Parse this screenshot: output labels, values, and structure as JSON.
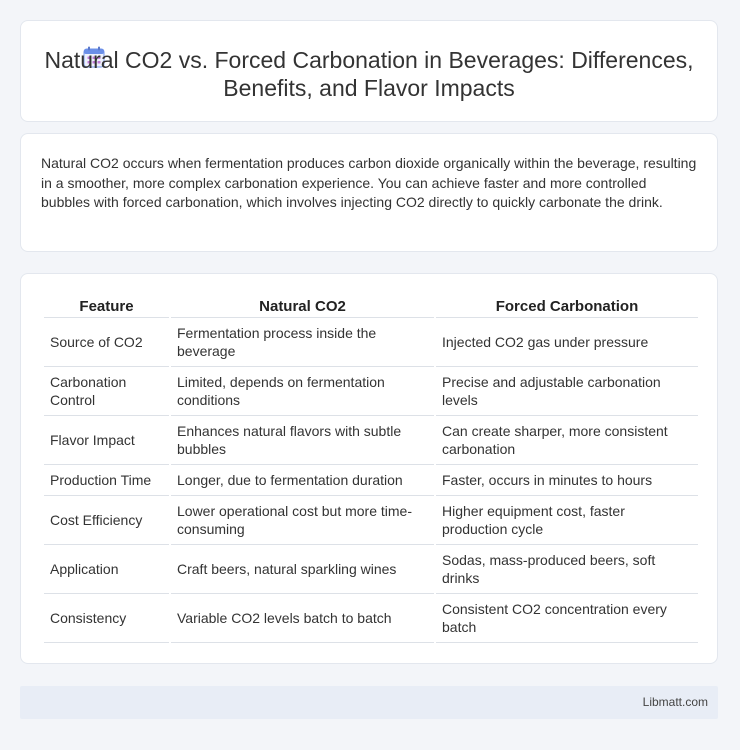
{
  "header": {
    "title": "Natural CO2 vs. Forced Carbonation in Beverages: Differences, Benefits, and Flavor Impacts",
    "icon": "calendar-icon"
  },
  "intro": {
    "text": "Natural CO2 occurs when fermentation produces carbon dioxide organically within the beverage, resulting in a smoother, more complex carbonation experience. You can achieve faster and more controlled bubbles with forced carbonation, which involves injecting CO2 directly to quickly carbonate the drink."
  },
  "table": {
    "headers": [
      "Feature",
      "Natural CO2",
      "Forced Carbonation"
    ],
    "rows": [
      [
        "Source of CO2",
        "Fermentation process inside the beverage",
        "Injected CO2 gas under pressure"
      ],
      [
        "Carbonation Control",
        "Limited, depends on fermentation conditions",
        "Precise and adjustable carbonation levels"
      ],
      [
        "Flavor Impact",
        "Enhances natural flavors with subtle bubbles",
        "Can create sharper, more consistent carbonation"
      ],
      [
        "Production Time",
        "Longer, due to fermentation duration",
        "Faster, occurs in minutes to hours"
      ],
      [
        "Cost Efficiency",
        "Lower operational cost but more time-consuming",
        "Higher equipment cost, faster production cycle"
      ],
      [
        "Application",
        "Craft beers, natural sparkling wines",
        "Sodas, mass-produced beers, soft drinks"
      ],
      [
        "Consistency",
        "Variable CO2 levels batch to batch",
        "Consistent CO2 concentration every batch"
      ]
    ]
  },
  "footer": {
    "text": "Libmatt.com"
  },
  "colors": {
    "background": "#f3f5f9",
    "card": "#ffffff",
    "footer": "#e8edf6",
    "icon_accent": "#6b8fe8"
  }
}
